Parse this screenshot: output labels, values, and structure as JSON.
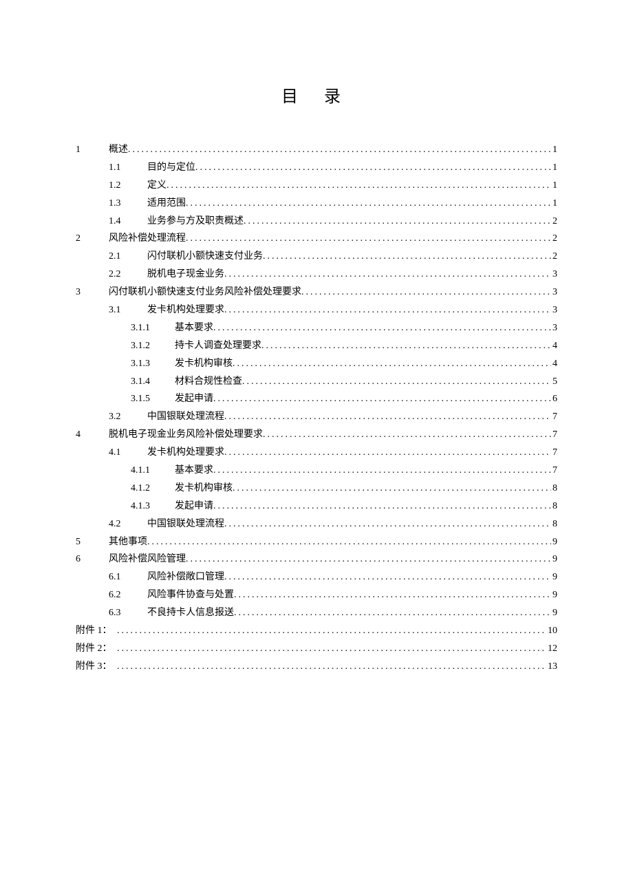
{
  "title": "目 录",
  "entries": [
    {
      "level": 1,
      "num": "1",
      "title": "概述",
      "page": "1"
    },
    {
      "level": 2,
      "num": "1.1",
      "title": "目的与定位",
      "page": "1"
    },
    {
      "level": 2,
      "num": "1.2",
      "title": "定义",
      "page": "1"
    },
    {
      "level": 2,
      "num": "1.3",
      "title": "适用范围",
      "page": "1"
    },
    {
      "level": 2,
      "num": "1.4",
      "title": "业务参与方及职责概述",
      "page": "2"
    },
    {
      "level": 1,
      "num": "2",
      "title": "风险补偿处理流程",
      "page": "2"
    },
    {
      "level": 2,
      "num": "2.1",
      "title": "闪付联机小额快速支付业务",
      "page": "2"
    },
    {
      "level": 2,
      "num": "2.2",
      "title": "脱机电子现金业务",
      "page": "3"
    },
    {
      "level": 1,
      "num": "3",
      "title": "闪付联机小额快速支付业务风险补偿处理要求",
      "page": "3"
    },
    {
      "level": 2,
      "num": "3.1",
      "title": "发卡机构处理要求",
      "page": "3"
    },
    {
      "level": 3,
      "num": "3.1.1",
      "title": "基本要求",
      "page": "3"
    },
    {
      "level": 3,
      "num": "3.1.2",
      "title": "持卡人调查处理要求",
      "page": "4"
    },
    {
      "level": 3,
      "num": "3.1.3",
      "title": "发卡机构审核",
      "page": "4"
    },
    {
      "level": 3,
      "num": "3.1.4",
      "title": "材料合规性检查",
      "page": "5"
    },
    {
      "level": 3,
      "num": "3.1.5",
      "title": "发起申请",
      "page": "6"
    },
    {
      "level": 2,
      "num": "3.2",
      "title": "中国银联处理流程",
      "page": "7"
    },
    {
      "level": 1,
      "num": "4",
      "title": "脱机电子现金业务风险补偿处理要求",
      "page": "7"
    },
    {
      "level": 2,
      "num": "4.1",
      "title": "发卡机构处理要求",
      "page": "7"
    },
    {
      "level": 3,
      "num": "4.1.1",
      "title": "基本要求",
      "page": "7"
    },
    {
      "level": 3,
      "num": "4.1.2",
      "title": "发卡机构审核",
      "page": "8"
    },
    {
      "level": 3,
      "num": "4.1.3",
      "title": "发起申请",
      "page": "8"
    },
    {
      "level": 2,
      "num": "4.2",
      "title": "中国银联处理流程",
      "page": "8"
    },
    {
      "level": 1,
      "num": "5",
      "title": "其他事项",
      "page": "9"
    },
    {
      "level": 1,
      "num": "6",
      "title": "风险补偿风险管理",
      "page": "9"
    },
    {
      "level": 2,
      "num": "6.1",
      "title": "风险补偿敞口管理",
      "page": "9"
    },
    {
      "level": 2,
      "num": "6.2",
      "title": "风险事件协查与处置",
      "page": "9"
    },
    {
      "level": 2,
      "num": "6.3",
      "title": "不良持卡人信息报送",
      "page": "9"
    },
    {
      "level": 0,
      "num": "附件 1：",
      "title": "",
      "page": "10"
    },
    {
      "level": 0,
      "num": "附件 2：",
      "title": "",
      "page": "12"
    },
    {
      "level": 0,
      "num": "附件 3：",
      "title": "",
      "page": "13"
    }
  ]
}
